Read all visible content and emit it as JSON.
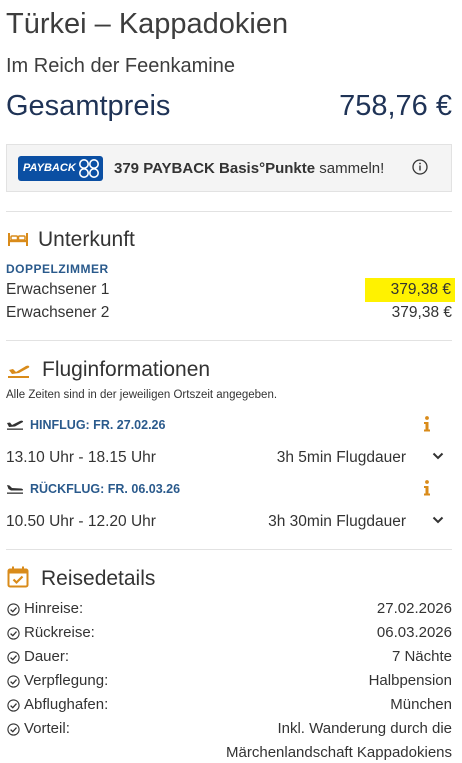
{
  "header": {
    "title": "Türkei – Kappadokien",
    "subtitle": "Im Reich der Feenkamine",
    "total_label": "Gesamtpreis",
    "total_price": "758,76 €"
  },
  "payback": {
    "logo_text": "PAYBACK",
    "points": "379 PAYBACK Basis°Punkte",
    "suffix": "sammeln!"
  },
  "accommodation": {
    "title": "Unterkunft",
    "room_type": "DOPPELZIMMER",
    "rows": [
      {
        "label": "Erwachsener 1",
        "price": "379,38 €",
        "highlighted": true
      },
      {
        "label": "Erwachsener 2",
        "price": "379,38 €",
        "highlighted": false
      }
    ]
  },
  "flights": {
    "title": "Fluginformationen",
    "note": "Alle Zeiten sind in der jeweiligen Ortszeit angegeben.",
    "outbound": {
      "label": "HINFLUG: FR. 27.02.26",
      "times": "13.10 Uhr - 18.15 Uhr",
      "duration": "3h 5min Flugdauer"
    },
    "return": {
      "label": "RÜCKFLUG: FR. 06.03.26",
      "times": "10.50 Uhr - 12.20 Uhr",
      "duration": "3h 30min Flugdauer"
    }
  },
  "details": {
    "title": "Reisedetails",
    "items": [
      {
        "label": "Hinreise:",
        "value": "27.02.2026"
      },
      {
        "label": "Rückreise:",
        "value": "06.03.2026"
      },
      {
        "label": "Dauer:",
        "value": "7 Nächte"
      },
      {
        "label": "Verpflegung:",
        "value": "Halbpension"
      },
      {
        "label": "Abflughafen:",
        "value": "München"
      },
      {
        "label": "Vorteil:",
        "value": "Inkl. Wanderung durch die",
        "value2": "Märchenlandschaft Kappadokiens"
      }
    ]
  },
  "colors": {
    "accent_orange": "#d98b1a",
    "brand_blue": "#1f3356",
    "link_blue": "#2a5a8c",
    "highlight": "#fff200",
    "payback_blue": "#0b4fa3"
  }
}
